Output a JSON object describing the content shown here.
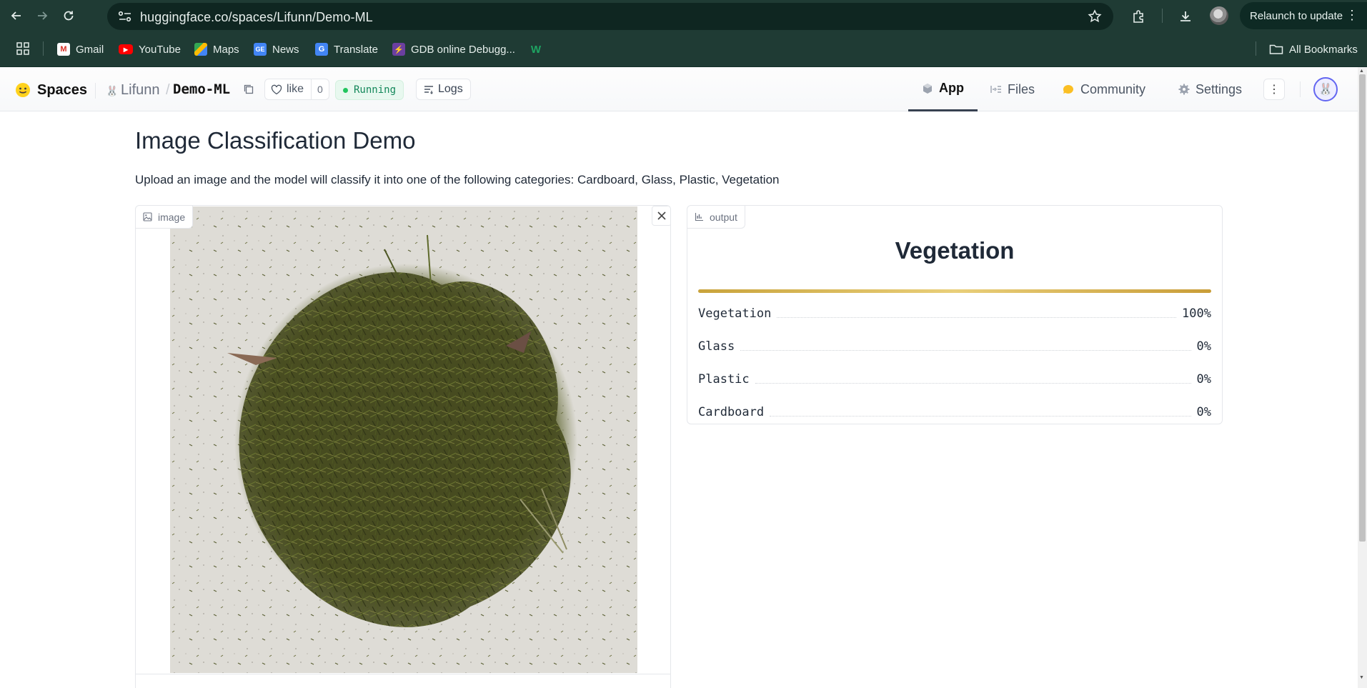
{
  "browser": {
    "url": "huggingface.co/spaces/Lifunn/Demo-ML",
    "relaunch_label": "Relaunch to update",
    "bookmarks": [
      {
        "label": "Gmail",
        "icon": "gmail-icon"
      },
      {
        "label": "YouTube",
        "icon": "youtube-icon"
      },
      {
        "label": "Maps",
        "icon": "maps-icon"
      },
      {
        "label": "News",
        "icon": "news-icon"
      },
      {
        "label": "Translate",
        "icon": "translate-icon"
      },
      {
        "label": "GDB online Debugg...",
        "icon": "gdb-icon"
      },
      {
        "label": "",
        "icon": "w-icon"
      }
    ],
    "all_bookmarks_label": "All Bookmarks"
  },
  "hf": {
    "spaces_label": "Spaces",
    "owner": "Lifunn",
    "separator": "/",
    "repo": "Demo-ML",
    "like_label": "like",
    "like_count": "0",
    "status": "Running",
    "logs_label": "Logs",
    "tabs": [
      {
        "label": "App",
        "icon": "cube-icon",
        "active": true
      },
      {
        "label": "Files",
        "icon": "files-icon",
        "active": false
      },
      {
        "label": "Community",
        "icon": "community-icon",
        "active": false
      },
      {
        "label": "Settings",
        "icon": "gear-icon",
        "active": false
      }
    ]
  },
  "app": {
    "title": "Image Classification Demo",
    "description": "Upload an image and the model will classify it into one of the following categories: Cardboard, Glass, Plastic, Vegetation",
    "image_panel": {
      "label": "image"
    },
    "output_panel": {
      "label": "output",
      "predicted": "Vegetation",
      "confidences": [
        {
          "label": "Vegetation",
          "value": "100%"
        },
        {
          "label": "Glass",
          "value": "0%"
        },
        {
          "label": "Plastic",
          "value": "0%"
        },
        {
          "label": "Cardboard",
          "value": "0%"
        }
      ]
    }
  },
  "colors": {
    "browser_chrome": "#1f3b34",
    "running_green": "#13875a",
    "confidence_bar": "#d4b24f"
  }
}
